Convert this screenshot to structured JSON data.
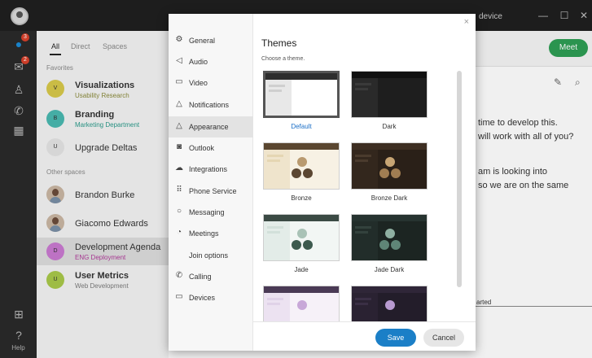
{
  "window": {
    "device_label": "device"
  },
  "rail": {
    "badge_messages": "3",
    "badge_teams": "2",
    "help_label": "Help"
  },
  "spaces": {
    "tabs": [
      {
        "label": "All"
      },
      {
        "label": "Direct"
      },
      {
        "label": "Spaces"
      }
    ],
    "favorites_label": "Favorites",
    "other_label": "Other spaces",
    "items": [
      {
        "initial": "V",
        "title": "Visualizations",
        "subtitle": "Usability Research",
        "subtitle_color": "#8a8a3a",
        "avatar_color": "#d7c84a"
      },
      {
        "initial": "B",
        "title": "Branding",
        "subtitle": "Marketing Department",
        "subtitle_color": "#2a9a8a",
        "avatar_color": "#4ab8b0"
      },
      {
        "initial": "U",
        "title": "Upgrade Deltas",
        "subtitle": "",
        "subtitle_color": "#888888",
        "avatar_color": "#e4e4e4"
      },
      {
        "initial": "",
        "title": "Brandon Burke",
        "subtitle": "",
        "subtitle_color": "#888888",
        "avatar_color": "#c9b6a3"
      },
      {
        "initial": "",
        "title": "Giacomo Edwards",
        "subtitle": "",
        "subtitle_color": "#888888",
        "avatar_color": "#c9b6a3"
      },
      {
        "initial": "D",
        "title": "Development Agenda",
        "subtitle": "ENG Deployment",
        "subtitle_color": "#b03a9a",
        "avatar_color": "#c97ad1"
      },
      {
        "initial": "U",
        "title": "User Metrics",
        "subtitle": "Web Development",
        "subtitle_color": "#7a7a7a",
        "avatar_color": "#a8c84a"
      }
    ]
  },
  "chat": {
    "meet_label": "Meet",
    "lines": [
      "time to develop this.",
      "will work with all of you?",
      "am is looking into",
      "so we are on the same"
    ],
    "partial_text": "arted"
  },
  "settings": {
    "close_label": "×",
    "nav": [
      {
        "label": "General",
        "icon": "gear-icon",
        "glyph": "⚙"
      },
      {
        "label": "Audio",
        "icon": "speaker-icon",
        "glyph": "◁"
      },
      {
        "label": "Video",
        "icon": "video-icon",
        "glyph": "▭"
      },
      {
        "label": "Notifications",
        "icon": "bell-icon",
        "glyph": "△"
      },
      {
        "label": "Appearance",
        "icon": "appearance-icon",
        "glyph": "△"
      },
      {
        "label": "Outlook",
        "icon": "outlook-icon",
        "glyph": "◙"
      },
      {
        "label": "Integrations",
        "icon": "cloud-icon",
        "glyph": "☁"
      },
      {
        "label": "Phone Service",
        "icon": "keypad-icon",
        "glyph": "⠿"
      },
      {
        "label": "Messaging",
        "icon": "message-icon",
        "glyph": "○"
      },
      {
        "label": "Meetings",
        "icon": "meetings-icon",
        "glyph": "◔"
      },
      {
        "label": "Join options",
        "icon": "",
        "glyph": ""
      },
      {
        "label": "Calling",
        "icon": "phone-icon",
        "glyph": "✆"
      },
      {
        "label": "Devices",
        "icon": "devices-icon",
        "glyph": "▭"
      }
    ],
    "active_nav": "Appearance",
    "title": "Themes",
    "subtitle": "Choose a theme.",
    "themes": [
      {
        "label": "Default",
        "selected": true,
        "bg": "#ffffff",
        "bar": "#2d2d2d",
        "side": "#e8e8e8",
        "line": "#cfcfcf",
        "dot1": null,
        "dot2": null
      },
      {
        "label": "Dark",
        "selected": false,
        "bg": "#1e1e1e",
        "bar": "#111111",
        "side": "#2a2a2a",
        "line": "#3a3a3a",
        "dot1": null,
        "dot2": null
      },
      {
        "label": "Bronze",
        "selected": false,
        "bg": "#f7f1e4",
        "bar": "#5a4630",
        "side": "#efe4cc",
        "line": "#e5d6b3",
        "dot1": "#b99a70",
        "dot2": "#5b4632"
      },
      {
        "label": "Bronze Dark",
        "selected": false,
        "bg": "#2a2018",
        "bar": "#3d2e22",
        "side": "#33271d",
        "line": "#4a3b2d",
        "dot1": "#c7a574",
        "dot2": "#a07d52"
      },
      {
        "label": "Jade",
        "selected": false,
        "bg": "#f2f6f4",
        "bar": "#3b4a44",
        "side": "#e3ece8",
        "line": "#d2e0da",
        "dot1": "#a9c2b6",
        "dot2": "#3d5a4e"
      },
      {
        "label": "Jade Dark",
        "selected": false,
        "bg": "#1c2522",
        "bar": "#263330",
        "side": "#222d2a",
        "line": "#33423d",
        "dot1": "#8fb0a2",
        "dot2": "#5f8577"
      },
      {
        "label": "",
        "selected": false,
        "bg": "#f6f1f8",
        "bar": "#4a3a55",
        "side": "#ece2f1",
        "line": "#e0d2e8",
        "dot1": "#c8a8d8",
        "dot2": null
      },
      {
        "label": "",
        "selected": false,
        "bg": "#231d2a",
        "bar": "#2f2638",
        "side": "#2a2232",
        "line": "#3a2f45",
        "dot1": "#b89ad0",
        "dot2": null
      }
    ],
    "save_label": "Save",
    "cancel_label": "Cancel"
  }
}
